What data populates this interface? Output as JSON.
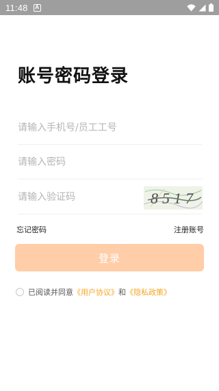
{
  "status_bar": {
    "time": "11:48",
    "notification_glyph": "A"
  },
  "page": {
    "title": "账号密码登录"
  },
  "form": {
    "phone_placeholder": "请输入手机号/员工工号",
    "password_placeholder": "请输入密码",
    "code_placeholder": "请输入验证码",
    "captcha_text": "8517"
  },
  "links": {
    "forgot": "忘记密码",
    "register": "注册账号"
  },
  "login_button": "登录",
  "agreement": {
    "prefix": "已阅读并同意",
    "user_agreement": "《用户协议》",
    "and": "和",
    "privacy_policy": "《隐私政策》"
  },
  "colors": {
    "accent": "#f5a623",
    "button_disabled": "#ffcda8",
    "status_bar": "#9e9e9e"
  }
}
